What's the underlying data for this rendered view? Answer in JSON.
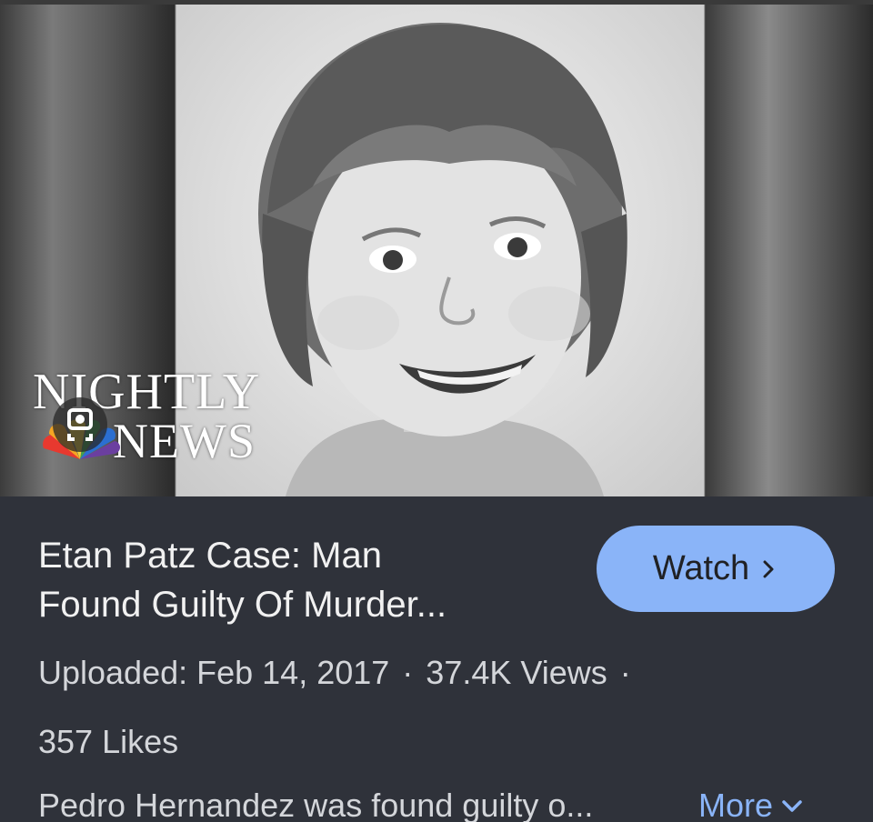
{
  "thumbnail": {
    "logo_line1": "NIGHTLY",
    "logo_line2": "NEWS",
    "icon": "google-lens-icon"
  },
  "video": {
    "title_line1": "Etan Patz Case: Man",
    "title_line2": "Found Guilty Of Murder...",
    "watch_label": "Watch",
    "uploaded": "Uploaded: Feb 14, 2017",
    "views": "37.4K Views",
    "separator": "·",
    "likes": "357 Likes",
    "description": "Pedro Hernandez was found guilty o...",
    "more_label": "More"
  },
  "colors": {
    "accent": "#8ab4f8",
    "panel_bg": "#2f323a",
    "text_primary": "#f1f1f1",
    "text_secondary": "#d4d6da"
  }
}
